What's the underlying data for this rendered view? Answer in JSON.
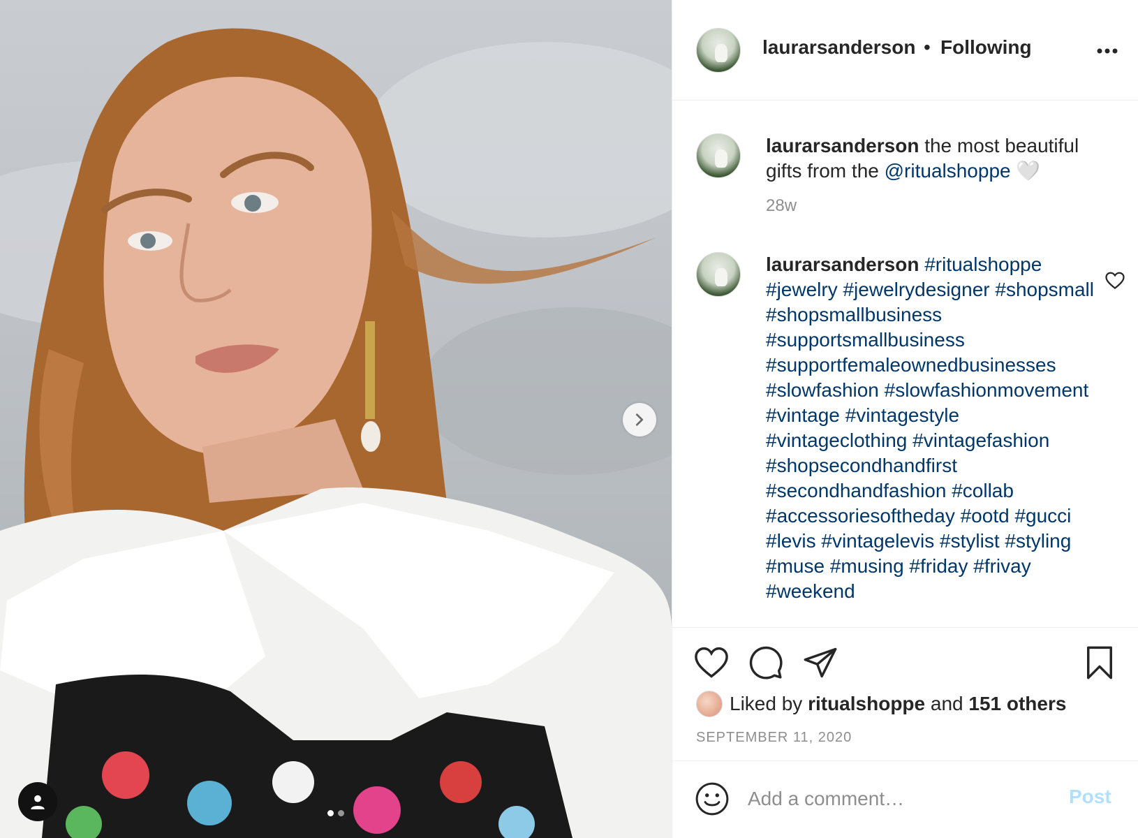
{
  "post": {
    "username": "laurarsanderson",
    "separator": "•",
    "follow_status": "Following"
  },
  "caption": {
    "username": "laurarsanderson",
    "text_before": " the most beautiful gifts from the ",
    "mention": "@ritualshoppe",
    "emoji": " 🤍",
    "time": "28w"
  },
  "comment": {
    "username": "laurarsanderson",
    "hashtags": "#ritualshoppe #jewelry #jewelrydesigner #shopsmall #shopsmallbusiness #supportsmallbusiness #supportfemaleownedbusinesses #slowfashion #slowfashionmovement #vintage #vintagestyle #vintageclothing #vintagefashion #shopsecondhandfirst #secondhandfashion #collab #accessoriesoftheday #ootd #gucci #levis #vintagelevis #stylist #styling #muse #musing #friday #frivay #weekend"
  },
  "likes": {
    "prefix": "Liked by ",
    "liker": "ritualshoppe",
    "middle": " and ",
    "count": "151 others"
  },
  "date": "SEPTEMBER 11, 2020",
  "comment_box": {
    "placeholder": "Add a comment…",
    "post_label": "Post"
  },
  "icons": {
    "more": "more-options-icon",
    "like": "heart-icon",
    "comment": "comment-icon",
    "share": "send-icon",
    "save": "bookmark-icon",
    "emoji": "emoji-icon",
    "next": "chevron-right-icon",
    "tag": "user-tag-icon"
  },
  "colors": {
    "link": "#00376b",
    "muted": "#8e8e8e",
    "post_disabled": "#b2dffc"
  }
}
